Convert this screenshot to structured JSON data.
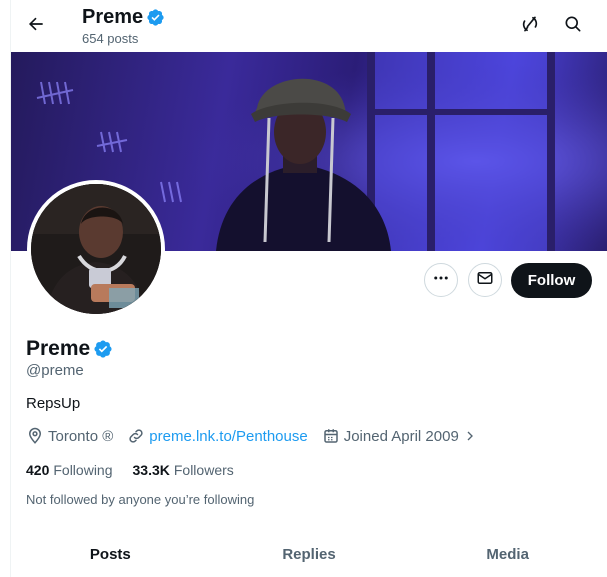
{
  "header": {
    "name": "Preme",
    "posts_count": "654 posts"
  },
  "profile": {
    "name": "Preme",
    "handle": "@preme",
    "bio": "RepsUp",
    "location": "Toronto ®",
    "website": "preme.lnk.to/Penthouse",
    "joined": "Joined April 2009",
    "following_count": "420",
    "following_label": "Following",
    "followers_count": "33.3K",
    "followers_label": "Followers",
    "not_followed_text": "Not followed by anyone you’re following"
  },
  "actions": {
    "follow_label": "Follow"
  },
  "tabs": [
    {
      "label": "Posts",
      "active": true
    },
    {
      "label": "Replies",
      "active": false
    },
    {
      "label": "Media",
      "active": false
    }
  ],
  "icons": {
    "back": "arrow-left-icon",
    "grok": "grok-icon",
    "search": "search-icon",
    "more": "more-icon",
    "message": "envelope-icon",
    "location": "location-pin-icon",
    "link": "link-icon",
    "calendar": "calendar-icon",
    "verified": "verified-badge-icon"
  },
  "colors": {
    "verified": "#1d9bf0",
    "link": "#1d9bf0",
    "follow_button": "#0f1419",
    "secondary_text": "#536471"
  }
}
